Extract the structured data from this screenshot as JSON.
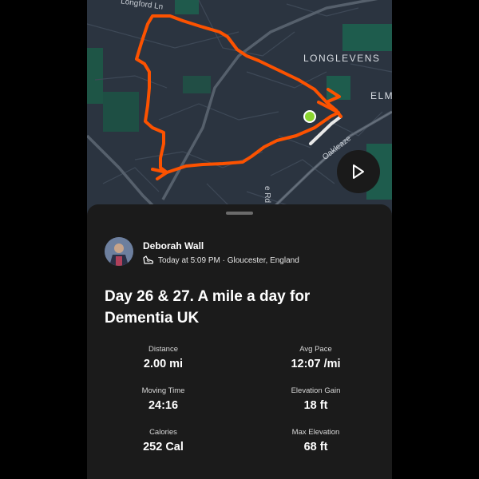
{
  "map": {
    "labels": {
      "area_1": "LONGLEVENS",
      "area_2": "ELM",
      "street_1": "Longford Ln",
      "street_2": "Oakleaze",
      "street_3": "e Rd"
    },
    "route_color": "#fc5200",
    "marker_color": "#8bd430",
    "play_icon": "play-icon"
  },
  "activity": {
    "athlete_name": "Deborah Wall",
    "meta": "Today at 5:09 PM · Gloucester, England",
    "sport_icon": "shoe-icon",
    "title": "Day 26 & 27. A mile a day for Dementia UK"
  },
  "stats": [
    {
      "label": "Distance",
      "value": "2.00 mi"
    },
    {
      "label": "Avg Pace",
      "value": "12:07 /mi"
    },
    {
      "label": "Moving Time",
      "value": "24:16"
    },
    {
      "label": "Elevation Gain",
      "value": "18 ft"
    },
    {
      "label": "Calories",
      "value": "252 Cal"
    },
    {
      "label": "Max Elevation",
      "value": "68 ft"
    }
  ]
}
